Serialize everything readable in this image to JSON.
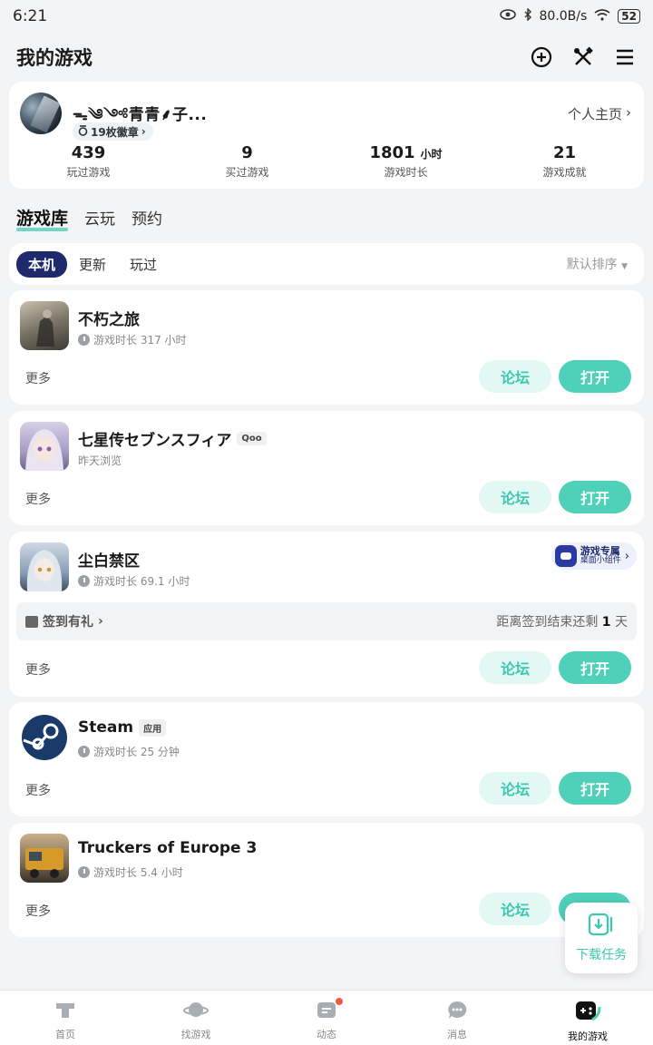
{
  "status_bar": {
    "time": "6:21",
    "speed": "80.0B/s",
    "battery": "52"
  },
  "header": {
    "title": "我的游戏"
  },
  "profile": {
    "nickname": "ᯓ༄༺青青⸙子...",
    "badges": "19枚徽章",
    "home_link": "个人主页",
    "stats": [
      {
        "value": "439",
        "unit": "",
        "label": "玩过游戏"
      },
      {
        "value": "9",
        "unit": "",
        "label": "买过游戏"
      },
      {
        "value": "1801",
        "unit": "小时",
        "label": "游戏时长"
      },
      {
        "value": "21",
        "unit": "",
        "label": "游戏成就"
      }
    ]
  },
  "main_tabs": [
    "游戏库",
    "云玩",
    "预约"
  ],
  "filters": {
    "chips": [
      "本机",
      "更新",
      "玩过"
    ],
    "sort": "默认排序"
  },
  "common": {
    "more": "更多",
    "forum": "论坛",
    "open": "打开"
  },
  "games": [
    {
      "title": "不朽之旅",
      "tag": "",
      "sub": "游戏时长 317 小时",
      "has_clock": true
    },
    {
      "title": "七星传セブンスフィア",
      "tag": "Qoo",
      "sub": "昨天浏览",
      "has_clock": false
    },
    {
      "title": "尘白禁区",
      "tag": "",
      "sub": "游戏时长 69.1 小时",
      "has_clock": true,
      "widget": {
        "line1": "游戏专属",
        "line2": "桌面小组件"
      },
      "signin": {
        "left": "签到有礼",
        "right_prefix": "距离签到结束还剩",
        "days": "1",
        "right_suffix": "天"
      }
    },
    {
      "title": "Steam",
      "tag": "应用",
      "sub": "游戏时长 25 分钟",
      "has_clock": true
    },
    {
      "title": "Truckers of Europe 3",
      "tag": "",
      "sub": "游戏时长 5.4 小时",
      "has_clock": true
    }
  ],
  "floating": {
    "label": "下载任务"
  },
  "bottom_nav": [
    "首页",
    "找游戏",
    "动态",
    "消息",
    "我的游戏"
  ],
  "colors": {
    "accent": "#4fd0b8",
    "chip_active": "#1e2a6b",
    "forum_bg": "#e3f7f3"
  }
}
